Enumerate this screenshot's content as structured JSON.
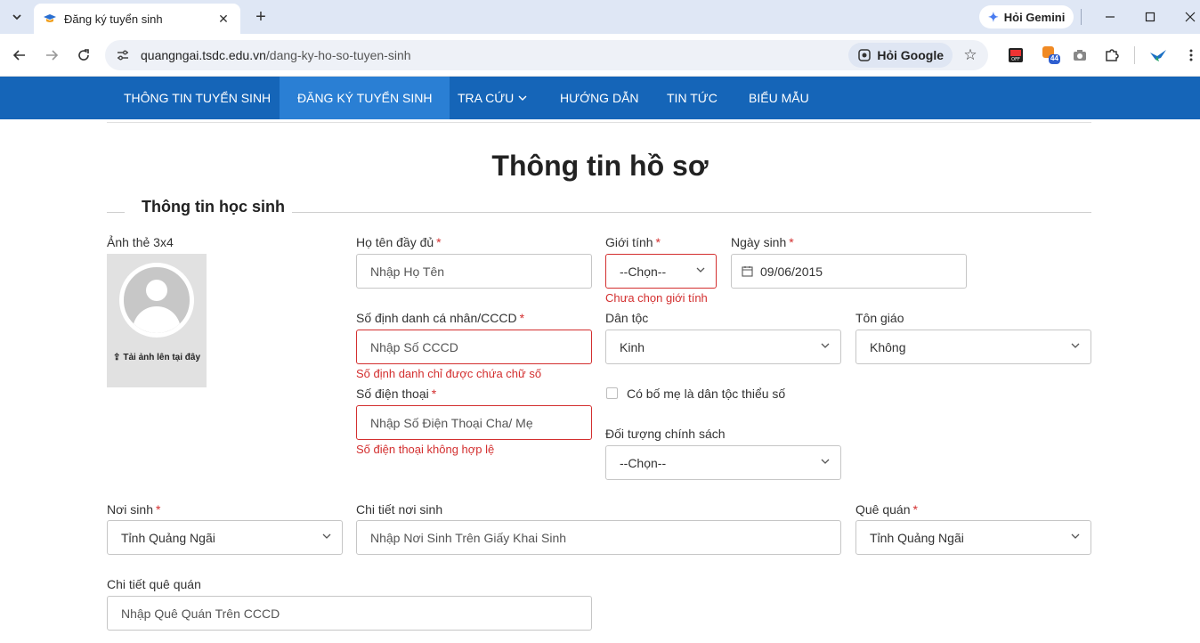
{
  "browser": {
    "tab_title": "Đăng ký tuyển sinh",
    "url_domain": "quangngai.tsdc.edu.vn",
    "url_path": "/dang-ky-ho-so-tuyen-sinh",
    "gemini_label": "Hỏi Gemini",
    "ask_google_label": "Hỏi Google",
    "extension_badge": "44"
  },
  "nav": {
    "items": [
      {
        "label": "THÔNG TIN TUYỂN SINH"
      },
      {
        "label": "ĐĂNG KÝ TUYỂN SINH"
      },
      {
        "label": "TRA CỨU"
      },
      {
        "label": "HƯỚNG DẪN"
      },
      {
        "label": "TIN TỨC"
      },
      {
        "label": "BIỂU MẪU"
      }
    ]
  },
  "page": {
    "title": "Thông tin hồ sơ",
    "section_title": "Thông tin học sinh"
  },
  "form": {
    "photo": {
      "label": "Ảnh thẻ 3x4",
      "upload_text": "Tải ảnh lên tại đây"
    },
    "full_name": {
      "label": "Họ tên đầy đủ",
      "placeholder": "Nhập Họ Tên"
    },
    "gender": {
      "label": "Giới tính",
      "value": "--Chọn--",
      "error": "Chưa chọn giới tính"
    },
    "dob": {
      "label": "Ngày sinh",
      "value": "09/06/2015"
    },
    "id_number": {
      "label": "Số định danh cá nhân/CCCD",
      "placeholder": "Nhập Số CCCD",
      "error": "Số định danh chỉ được chứa chữ số"
    },
    "ethnicity": {
      "label": "Dân tộc",
      "value": "Kinh"
    },
    "religion": {
      "label": "Tôn giáo",
      "value": "Không"
    },
    "phone": {
      "label": "Số điện thoại",
      "placeholder": "Nhập Số Điện Thoại Cha/ Mẹ",
      "error": "Số điện thoại không hợp lệ"
    },
    "minority_parent": {
      "label": "Có bố mẹ là dân tộc thiểu số",
      "checked": false
    },
    "policy": {
      "label": "Đối tượng chính sách",
      "value": "--Chọn--"
    },
    "birthplace": {
      "label": "Nơi sinh",
      "value": "Tỉnh Quảng Ngãi"
    },
    "birthplace_detail": {
      "label": "Chi tiết nơi sinh",
      "placeholder": "Nhập Nơi Sinh Trên Giấy Khai Sinh"
    },
    "hometown": {
      "label": "Quê quán",
      "value": "Tỉnh Quảng Ngãi"
    },
    "hometown_detail": {
      "label": "Chi tiết quê quán",
      "placeholder": "Nhập Quê Quán Trên CCCD"
    }
  },
  "colors": {
    "nav_bg": "#1565b8",
    "nav_active": "#2a7fd4",
    "error": "#d32f2f"
  }
}
